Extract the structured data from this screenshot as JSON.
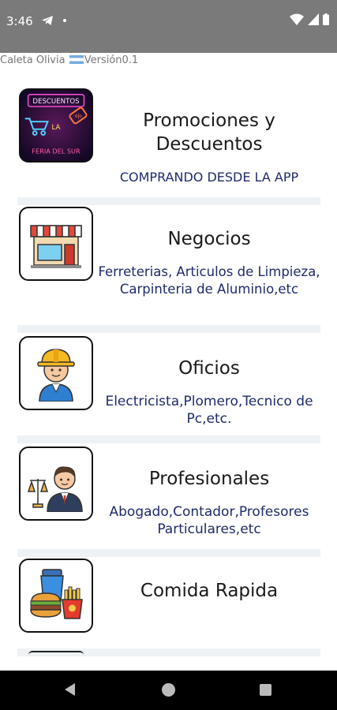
{
  "status_bar": {
    "time": "3:46",
    "icons": [
      "telegram-icon",
      "notification-dot-icon",
      "wifi-icon",
      "signal-icon",
      "battery-icon"
    ]
  },
  "header": {
    "city": "Caleta Olivia",
    "flag_icon": "argentina-flag-icon",
    "version": "Versión0.1"
  },
  "categories": [
    {
      "title": "Promociones y Descuentos",
      "description": "COMPRANDO DESDE LA APP",
      "icon": "neon-discounts-icon",
      "icon_text_top": "DESCUENTOS",
      "icon_text_mid": "LA",
      "icon_text_bottom": "FERIA DEL SUR"
    },
    {
      "title": "Negocios",
      "description": "Ferreterias, Articulos de Limpieza, Carpinteria de Aluminio,etc",
      "icon": "store-icon"
    },
    {
      "title": "Oficios",
      "description": "Electricista,Plomero,Tecnico de Pc,etc.",
      "icon": "construction-worker-icon"
    },
    {
      "title": "Profesionales",
      "description": "Abogado,Contador,Profesores Particulares,etc",
      "icon": "lawyer-icon"
    },
    {
      "title": "Comida Rapida",
      "description": "",
      "icon": "fast-food-icon"
    }
  ],
  "nav": {
    "icons": [
      "back-icon",
      "home-icon",
      "recents-icon"
    ]
  },
  "colors": {
    "status_bar": "#7a7a7a",
    "description_text": "#1f2a6b",
    "separator": "#eef2f4"
  }
}
